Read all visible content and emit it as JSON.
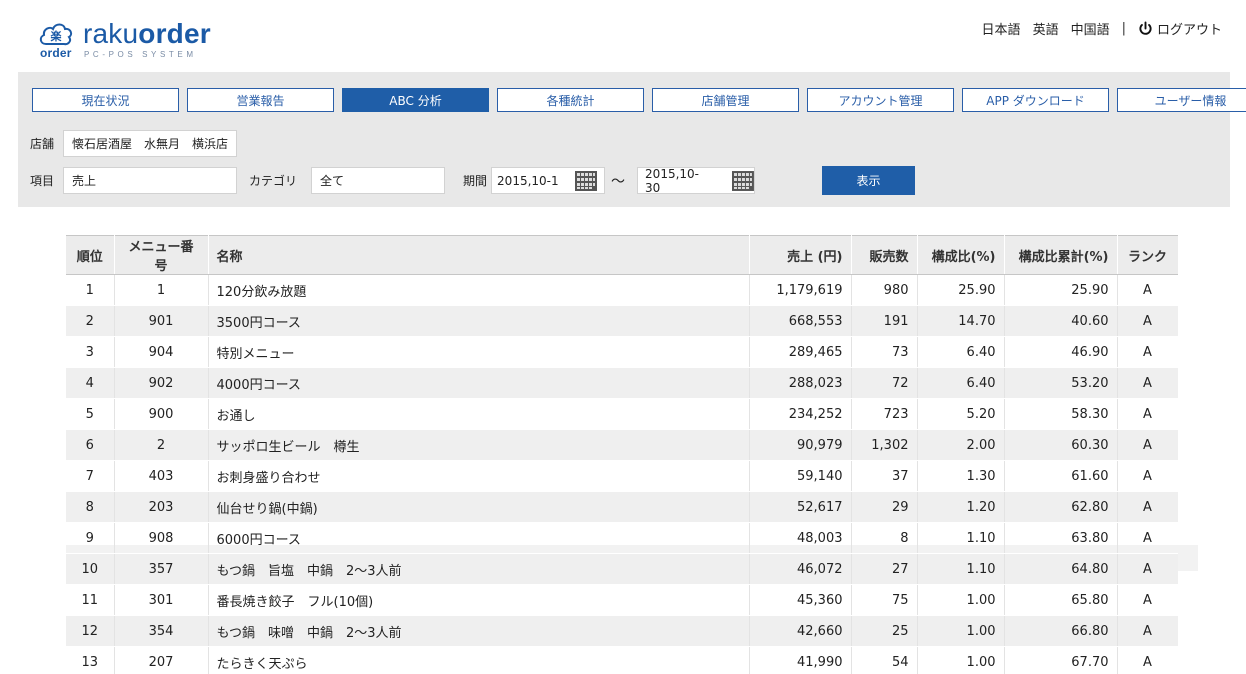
{
  "header": {
    "logo_text": "raku",
    "logo_text_bold": "order",
    "logo_sub": "PC-POS SYSTEM",
    "logo_order": "order",
    "logo_mark": "楽",
    "lang_ja": "日本語",
    "lang_en": "英語",
    "lang_zh": "中国語",
    "separator": "|",
    "logout": "ログアウト"
  },
  "tabs": [
    {
      "label": "現在状況",
      "active": false
    },
    {
      "label": "営業報告",
      "active": false
    },
    {
      "label": "ABC 分析",
      "active": true
    },
    {
      "label": "各種統計",
      "active": false
    },
    {
      "label": "店舗管理",
      "active": false
    },
    {
      "label": "アカウント管理",
      "active": false
    },
    {
      "label": "APP ダウンロード",
      "active": false
    },
    {
      "label": "ユーザー情報",
      "active": false
    }
  ],
  "filters": {
    "store_label": "店舗",
    "store_value": "懐石居酒屋　水無月　横浜店",
    "item_label": "項目",
    "item_value": "売上",
    "category_label": "カテゴリ",
    "category_value": "全て",
    "period_label": "期間",
    "date_from": "2015,10-1",
    "tilde": "～",
    "date_to": "2015,10-30",
    "show_button": "表示"
  },
  "table": {
    "headers": [
      "順位",
      "メニュー番号",
      "名称",
      "売上 (円)",
      "販売数",
      "構成比(%)",
      "構成比累計(%)",
      "ランク"
    ],
    "rows": [
      [
        "1",
        "1",
        "120分飲み放題",
        "1,179,619",
        "980",
        "25.90",
        "25.90",
        "A"
      ],
      [
        "2",
        "901",
        "3500円コース",
        "668,553",
        "191",
        "14.70",
        "40.60",
        "A"
      ],
      [
        "3",
        "904",
        "特別メニュー",
        "289,465",
        "73",
        "6.40",
        "46.90",
        "A"
      ],
      [
        "4",
        "902",
        "4000円コース",
        "288,023",
        "72",
        "6.40",
        "53.20",
        "A"
      ],
      [
        "5",
        "900",
        "お通し",
        "234,252",
        "723",
        "5.20",
        "58.30",
        "A"
      ],
      [
        "6",
        "2",
        "サッポロ生ビール　樽生",
        "90,979",
        "1,302",
        "2.00",
        "60.30",
        "A"
      ],
      [
        "7",
        "403",
        "お刺身盛り合わせ",
        "59,140",
        "37",
        "1.30",
        "61.60",
        "A"
      ],
      [
        "8",
        "203",
        "仙台せり鍋(中鍋)",
        "52,617",
        "29",
        "1.20",
        "62.80",
        "A"
      ],
      [
        "9",
        "908",
        "6000円コース",
        "48,003",
        "8",
        "1.10",
        "63.80",
        "A"
      ],
      [
        "10",
        "357",
        "もつ鍋　旨塩　中鍋　2～3人前",
        "46,072",
        "27",
        "1.10",
        "64.80",
        "A"
      ],
      [
        "11",
        "301",
        "番長焼き餃子　フル(10個)",
        "45,360",
        "75",
        "1.00",
        "65.80",
        "A"
      ],
      [
        "12",
        "354",
        "もつ鍋　味噌　中鍋　2～3人前",
        "42,660",
        "25",
        "1.00",
        "66.80",
        "A"
      ],
      [
        "13",
        "207",
        "たらきく天ぷら",
        "41,990",
        "54",
        "1.00",
        "67.70",
        "A"
      ]
    ]
  },
  "colors": {
    "brand_blue": "#1b5aa6",
    "tab_active": "#1f5ea8",
    "panel_bg": "#e8e8e8"
  }
}
